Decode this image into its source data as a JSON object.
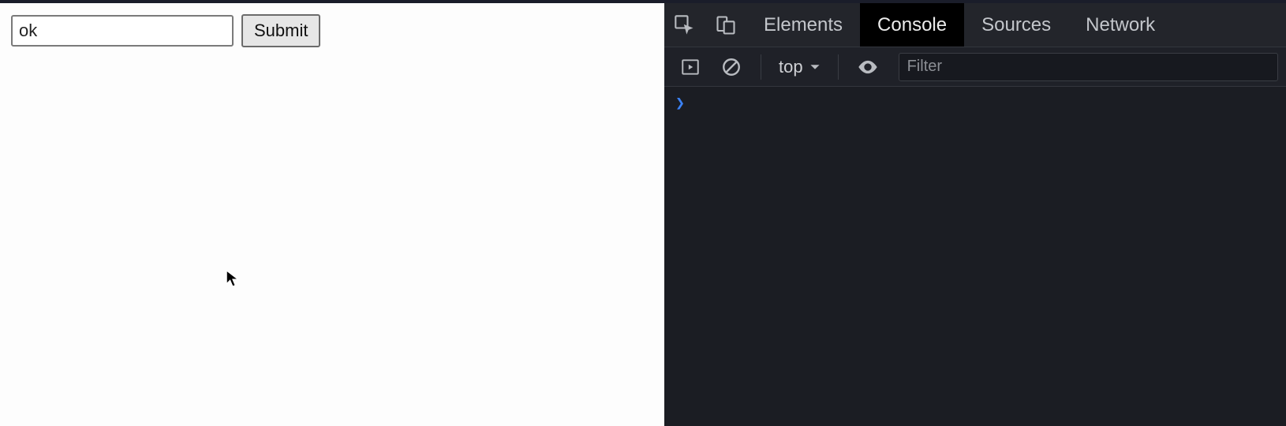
{
  "page": {
    "input_value": "ok",
    "submit_label": "Submit"
  },
  "devtools": {
    "tabs": {
      "elements": "Elements",
      "console": "Console",
      "sources": "Sources",
      "network": "Network",
      "active": "Console"
    },
    "toolbar": {
      "context_label": "top",
      "filter_placeholder": "Filter"
    },
    "console": {
      "prompt": "❯"
    }
  }
}
